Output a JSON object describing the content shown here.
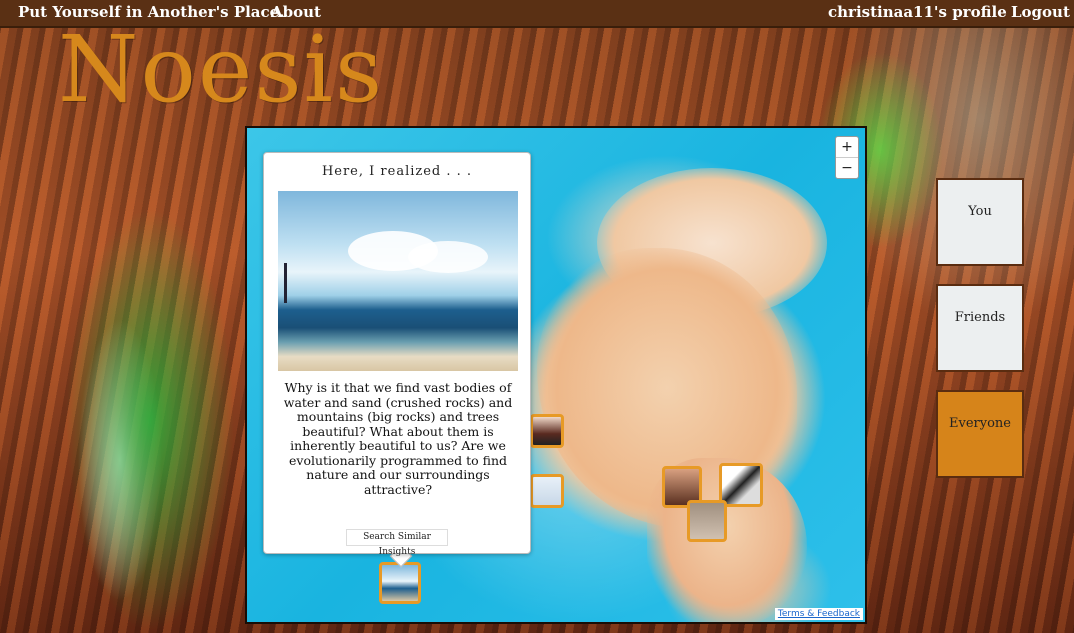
{
  "nav": {
    "tagline": "Put Yourself in Another's Place.",
    "about": "About",
    "profile": "christinaa11's profile",
    "logout": "Logout"
  },
  "logo": "Noesis",
  "map": {
    "zoom_in": "+",
    "zoom_out": "−",
    "terms": "Terms & Feedback"
  },
  "popup": {
    "title": "Here, I realized . . .",
    "body": "Why is it that we find vast bodies of water and sand (crushed rocks) and mountains (big rocks) and trees beautiful? What about them is inherently beautiful to us? Are we evolutionarily programmed to find nature and our surroundings attractive?",
    "search_button": "Search Similar Insights"
  },
  "filters": [
    "You",
    "Friends",
    "Everyone"
  ],
  "active_filter": "Everyone",
  "colors": {
    "accent": "#d6881c",
    "topbar": "#5a3014",
    "marker_border": "#e79a26"
  }
}
